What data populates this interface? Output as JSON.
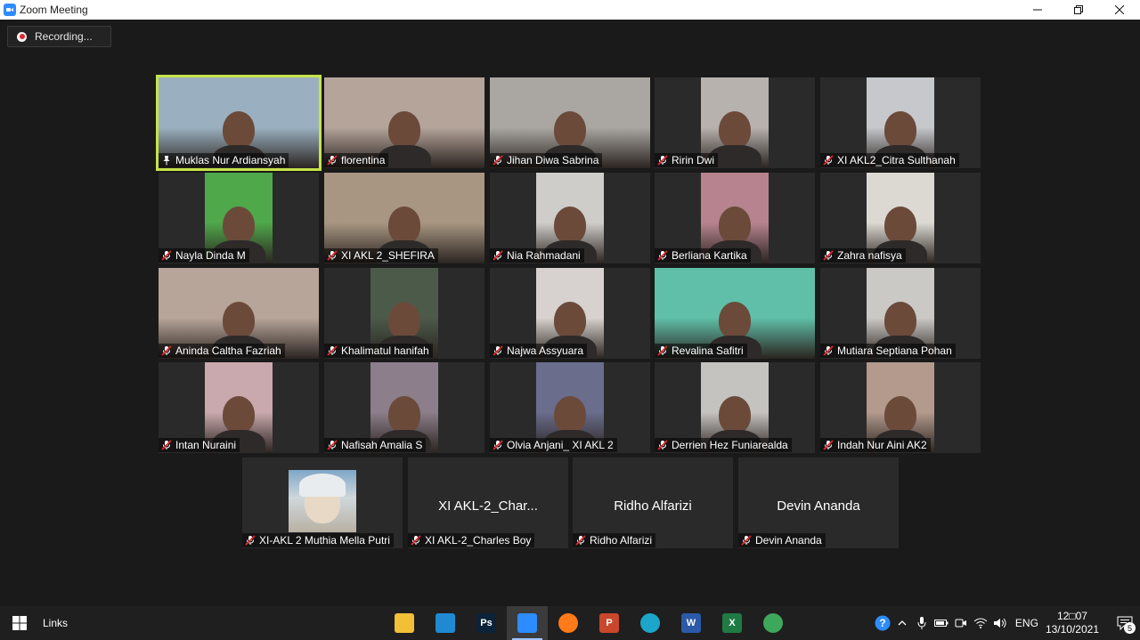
{
  "window": {
    "title": "Zoom Meeting",
    "controls": {
      "minimize": "minimize",
      "restore": "restore",
      "close": "close"
    }
  },
  "meeting": {
    "recording_label": "Recording...",
    "tiles": [
      {
        "name": "Muklas Nur Ardiansyah",
        "type": "video",
        "active": true,
        "muted": false,
        "bg": "#9ab0c0"
      },
      {
        "name": "florentina",
        "type": "video",
        "muted": true,
        "bg": "#b4a49a"
      },
      {
        "name": "Jihan Diwa Sabrina",
        "type": "video",
        "muted": true,
        "bg": "#aaa7a3"
      },
      {
        "name": "Ririn Dwi",
        "type": "video",
        "muted": true,
        "bg": "#b7b2ae"
      },
      {
        "name": "XI AKL2_Citra Sulthanah",
        "type": "video",
        "muted": true,
        "bg": "#c6c8cc"
      },
      {
        "name": "Nayla Dinda M",
        "type": "video",
        "muted": true,
        "bg": "#4fa84a"
      },
      {
        "name": "XI AKL 2_SHEFIRA",
        "type": "video",
        "muted": true,
        "bg": "#a89682"
      },
      {
        "name": "Nia Rahmadani",
        "type": "video",
        "muted": true,
        "bg": "#cfcdca"
      },
      {
        "name": "Berliana Kartika",
        "type": "video",
        "muted": true,
        "bg": "#b6838f"
      },
      {
        "name": "Zahra nafisya",
        "type": "video",
        "muted": true,
        "bg": "#dcd9d3"
      },
      {
        "name": "Aninda Caltha Fazriah",
        "type": "video",
        "muted": true,
        "bg": "#b8a59a"
      },
      {
        "name": "Khalimatul hanifah",
        "type": "video",
        "muted": true,
        "bg": "#4c5a4a"
      },
      {
        "name": "Najwa Assyuara",
        "type": "video",
        "muted": true,
        "bg": "#d7d2cf"
      },
      {
        "name": "Revalina Safitri",
        "type": "video",
        "muted": true,
        "bg": "#5fbfa8"
      },
      {
        "name": "Mutiara Septiana Pohan",
        "type": "video",
        "muted": true,
        "bg": "#cbc9c6"
      },
      {
        "name": "Intan Nuraini",
        "type": "video",
        "muted": true,
        "bg": "#c9a9ad"
      },
      {
        "name": "Nafisah Amalia S",
        "type": "video",
        "muted": true,
        "bg": "#8c7e8a"
      },
      {
        "name": "Olvia Anjani_ XI AKL 2",
        "type": "video",
        "muted": true,
        "bg": "#6a6d8c"
      },
      {
        "name": "Derrien Hez Funiarealda",
        "type": "video",
        "muted": true,
        "bg": "#c5c3c0"
      },
      {
        "name": "Indah Nur Aini AK2",
        "type": "video",
        "muted": true,
        "bg": "#b39a8c"
      },
      {
        "name": "XI-AKL 2 Muthia Mella Putri",
        "type": "avatar",
        "muted": true
      },
      {
        "name": "XI AKL-2_Charles Boy",
        "type": "name",
        "display_name": "XI  AKL-2_Char...",
        "muted": true
      },
      {
        "name": "Ridho Alfarizi",
        "type": "name",
        "display_name": "Ridho Alfarizi",
        "muted": true
      },
      {
        "name": "Devin Ananda",
        "type": "name",
        "display_name": "Devin Ananda",
        "muted": true
      }
    ]
  },
  "taskbar": {
    "links_label": "Links",
    "apps": [
      {
        "name": "file-explorer-icon",
        "label": "",
        "color": "#f2c037"
      },
      {
        "name": "visual-studio-code-icon",
        "label": "",
        "color": "#1f8ad2"
      },
      {
        "name": "photoshop-icon",
        "label": "Ps",
        "color": "#0b2238"
      },
      {
        "name": "zoom-icon",
        "label": "",
        "color": "#2d8cff",
        "active": true
      },
      {
        "name": "firefox-icon",
        "label": "",
        "color": "#ff7a18"
      },
      {
        "name": "powerpoint-icon",
        "label": "P",
        "color": "#c9472a"
      },
      {
        "name": "edge-icon",
        "label": "",
        "color": "#1ca6c9"
      },
      {
        "name": "word-icon",
        "label": "W",
        "color": "#2b5aa8"
      },
      {
        "name": "excel-icon",
        "label": "X",
        "color": "#1f7a44"
      },
      {
        "name": "chrome-icon",
        "label": "",
        "color": "#3da75a"
      }
    ],
    "tray": {
      "language": "ENG",
      "time": "12□07",
      "date": "13/10/2021",
      "notification_count": "5"
    }
  }
}
